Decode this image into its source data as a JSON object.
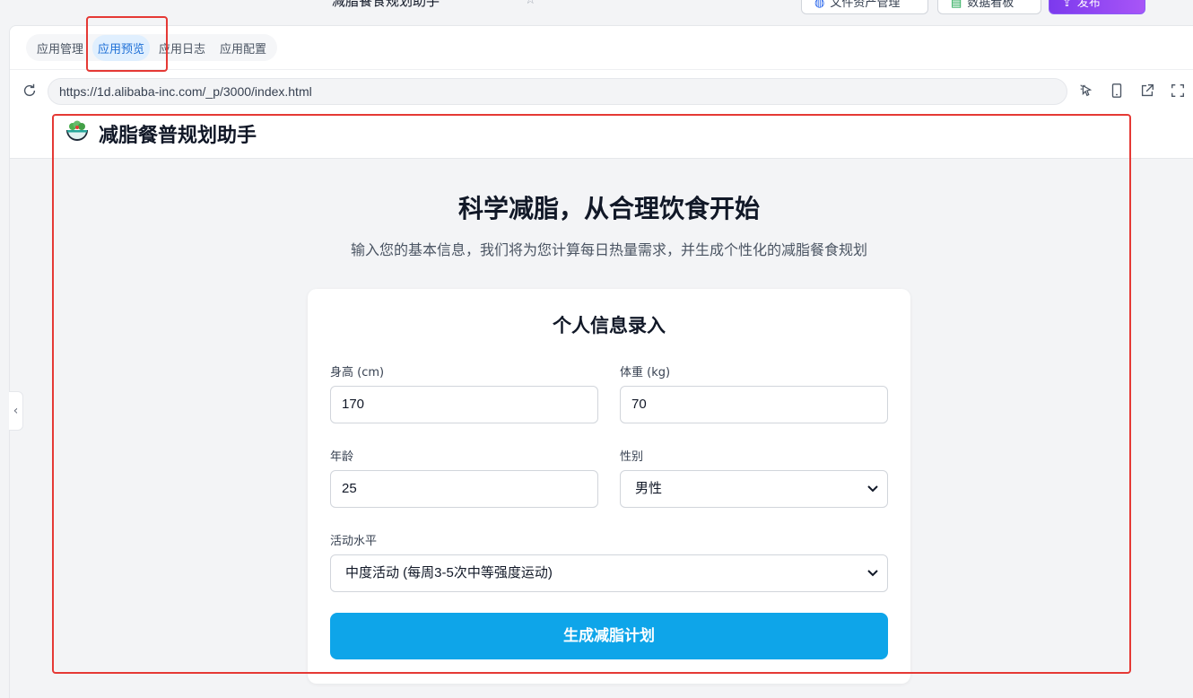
{
  "host": {
    "window_title": "减脂餐食规划助手",
    "buttons": [
      {
        "label": "文件资产管理"
      },
      {
        "label": "数据看板"
      },
      {
        "label": "发布"
      }
    ]
  },
  "tabs": [
    {
      "label": "应用管理",
      "active": false
    },
    {
      "label": "应用预览",
      "active": true
    },
    {
      "label": "应用日志",
      "active": false
    },
    {
      "label": "应用配置",
      "active": false
    }
  ],
  "browser": {
    "url": "https://1d.alibaba-inc.com/_p/3000/index.html"
  },
  "app": {
    "title": "减脂餐普规划助手",
    "hero_title": "科学减脂，从合理饮食开始",
    "hero_subtitle": "输入您的基本信息，我们将为您计算每日热量需求，并生成个性化的减脂餐食规划",
    "form": {
      "title": "个人信息录入",
      "height_label": "身高 (cm)",
      "height_value": "170",
      "weight_label": "体重 (kg)",
      "weight_value": "70",
      "age_label": "年龄",
      "age_value": "25",
      "gender_label": "性别",
      "gender_value": "男性",
      "activity_label": "活动水平",
      "activity_value": "中度活动 (每周3-5次中等强度运动)",
      "submit_label": "生成减脂计划"
    }
  },
  "colors": {
    "accent": "#0ea5e9",
    "tab_active_bg": "#e0effe",
    "tab_active_text": "#1d6fd6",
    "annotation": "#e53935",
    "publish": "#8b5cf6"
  }
}
